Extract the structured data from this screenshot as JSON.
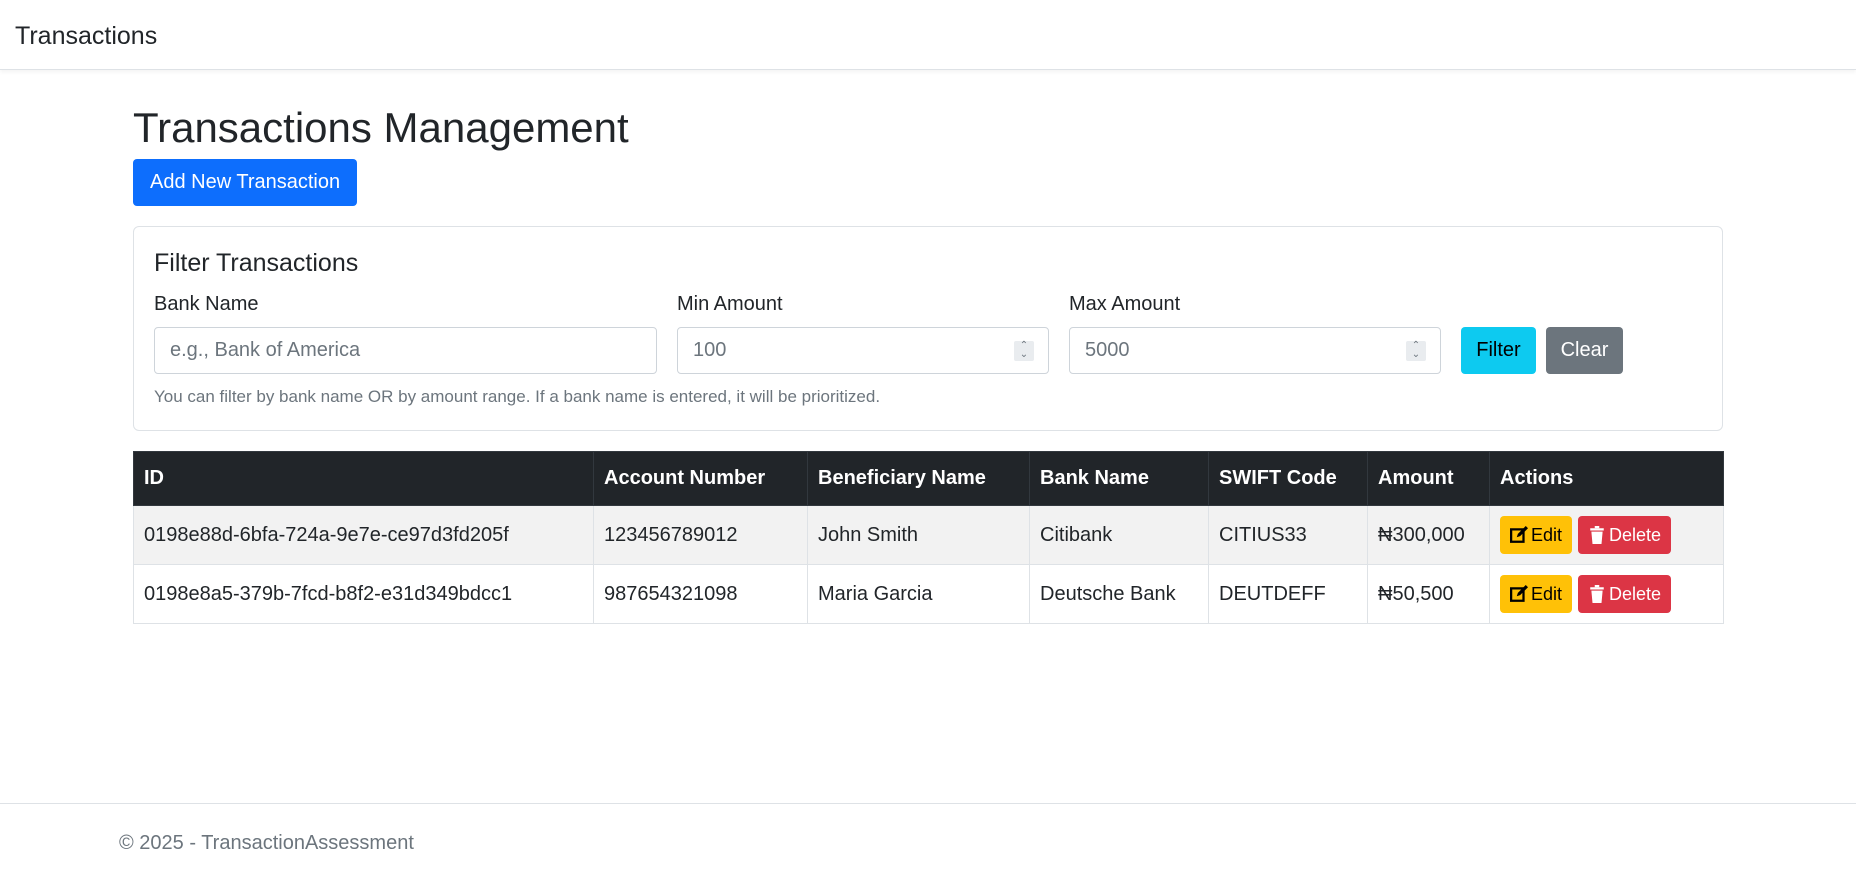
{
  "navbar": {
    "brand": "Transactions"
  },
  "main": {
    "title": "Transactions Management",
    "add_button": "Add New Transaction"
  },
  "filter": {
    "title": "Filter Transactions",
    "bank_label": "Bank Name",
    "bank_placeholder": "e.g., Bank of America",
    "min_label": "Min Amount",
    "min_value": "100",
    "max_label": "Max Amount",
    "max_value": "5000",
    "filter_button": "Filter",
    "clear_button": "Clear",
    "help": "You can filter by bank name OR by amount range. If a bank name is entered, it will be prioritized."
  },
  "table": {
    "headers": [
      "ID",
      "Account Number",
      "Beneficiary Name",
      "Bank Name",
      "SWIFT Code",
      "Amount",
      "Actions"
    ],
    "rows": [
      {
        "id": "0198e88d-6bfa-724a-9e7e-ce97d3fd205f",
        "account": "123456789012",
        "beneficiary": "John Smith",
        "bank": "Citibank",
        "swift": "CITIUS33",
        "amount": "₦300,000"
      },
      {
        "id": "0198e8a5-379b-7fcd-b8f2-e31d349bdcc1",
        "account": "987654321098",
        "beneficiary": "Maria Garcia",
        "bank": "Deutsche Bank",
        "swift": "DEUTDEFF",
        "amount": "₦50,500"
      }
    ],
    "edit_label": "Edit",
    "delete_label": "Delete"
  },
  "footer": {
    "text": "© 2025 - TransactionAssessment"
  },
  "colors": {
    "primary": "#0d6efd",
    "info": "#0dcaf0",
    "secondary": "#6c757d",
    "warning": "#ffc107",
    "danger": "#dc3545",
    "dark": "#212529"
  },
  "icons": [
    "edit-icon",
    "trash-icon"
  ]
}
